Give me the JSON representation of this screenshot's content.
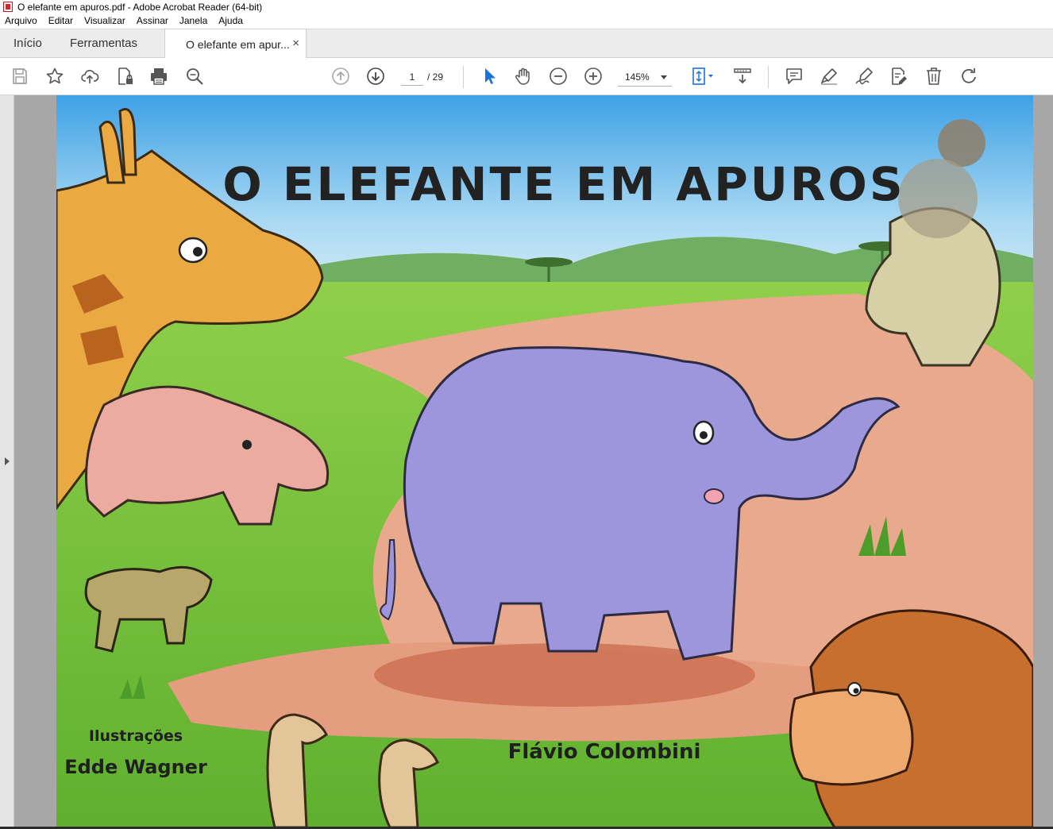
{
  "window": {
    "title": "O elefante em apuros.pdf - Adobe Acrobat Reader (64-bit)"
  },
  "menu": [
    "Arquivo",
    "Editar",
    "Visualizar",
    "Assinar",
    "Janela",
    "Ajuda"
  ],
  "tabs": {
    "home": "Início",
    "tools": "Ferramentas",
    "document": "O elefante em apur...",
    "close_glyph": "×"
  },
  "toolbar": {
    "icons": [
      "save-icon",
      "bookmark-star-icon",
      "upload-cloud-icon",
      "protect-file-icon",
      "print-icon",
      "search-zoom-icon",
      "page-up-icon",
      "page-down-icon",
      "select-cursor-icon",
      "hand-tool-icon",
      "zoom-out-icon",
      "zoom-in-icon",
      "fit-page-icon",
      "scroll-mode-icon",
      "comment-icon",
      "highlight-icon",
      "sign-icon",
      "edit-pdf-icon",
      "delete-icon",
      "rotate-icon"
    ],
    "current_page": "1",
    "page_total": "/ 29",
    "zoom": "145%"
  },
  "document": {
    "cover_title": "O ELEFANTE EM APUROS",
    "illustrations_label": "Ilustrações",
    "illustrator": "Edde Wagner",
    "author": "Flávio Colombini"
  },
  "colors": {
    "accent_blue": "#1a73d9",
    "icon_gray": "#555555",
    "doc_background": "#a7a7a7"
  }
}
